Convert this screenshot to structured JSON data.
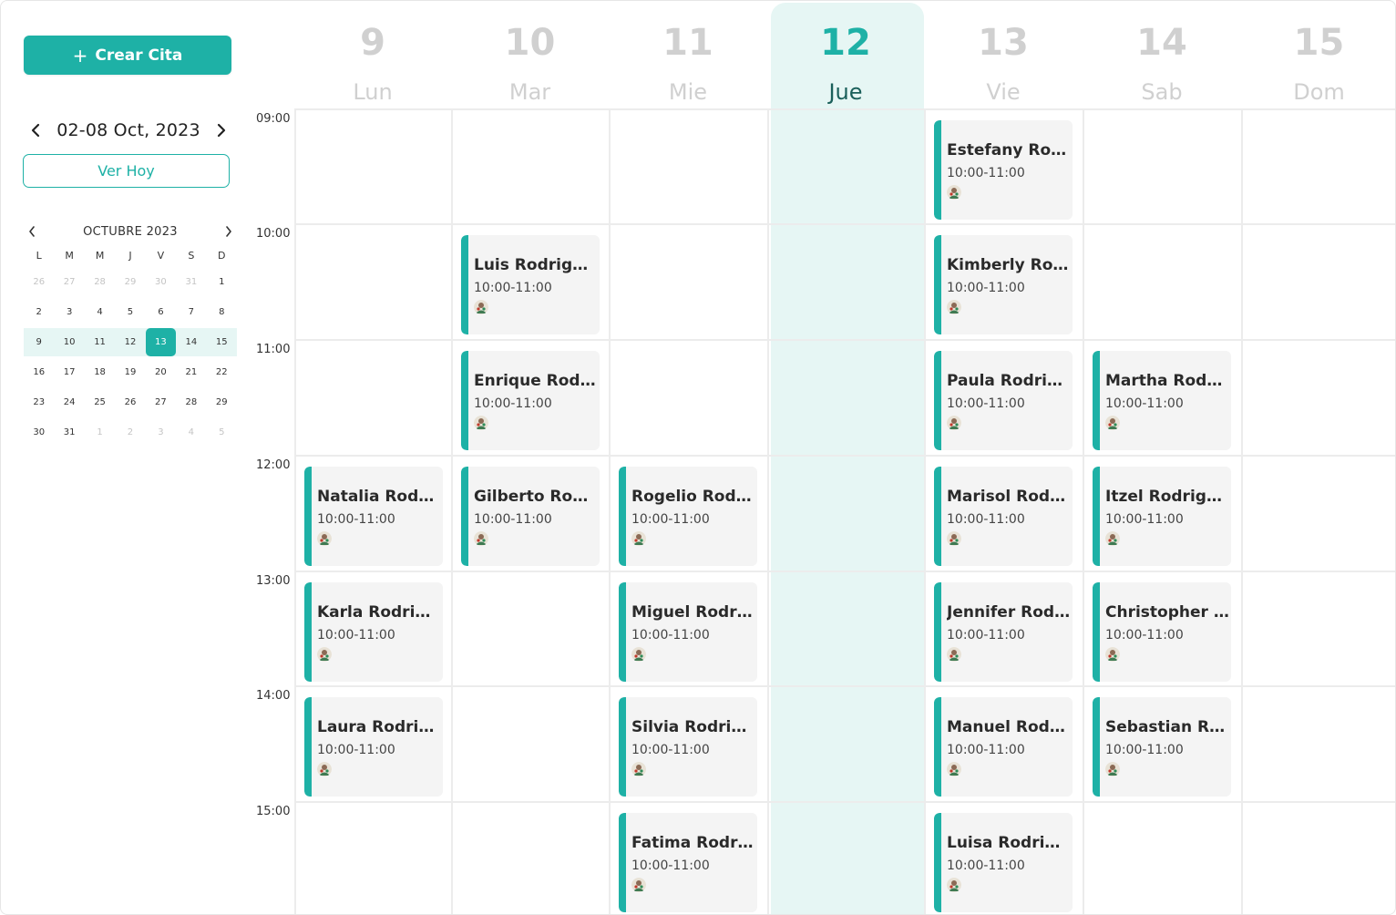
{
  "sidebar": {
    "create_label": "Crear Cita",
    "range_label": "02-08 Oct, 2023",
    "today_label": "Ver Hoy",
    "mini": {
      "title": "OCTUBRE 2023",
      "dow": [
        "L",
        "M",
        "M",
        "J",
        "V",
        "S",
        "D"
      ],
      "weeks": [
        [
          "26",
          "27",
          "28",
          "29",
          "30",
          "31",
          "1"
        ],
        [
          "2",
          "3",
          "4",
          "5",
          "6",
          "7",
          "8"
        ],
        [
          "9",
          "10",
          "11",
          "12",
          "13",
          "14",
          "15"
        ],
        [
          "16",
          "17",
          "18",
          "19",
          "20",
          "21",
          "22"
        ],
        [
          "23",
          "24",
          "25",
          "26",
          "27",
          "28",
          "29"
        ],
        [
          "30",
          "31",
          "1",
          "2",
          "3",
          "4",
          "5"
        ]
      ],
      "selected_day": "13"
    }
  },
  "days": [
    {
      "num": "9",
      "name": "Lun"
    },
    {
      "num": "10",
      "name": "Mar"
    },
    {
      "num": "11",
      "name": "Mie"
    },
    {
      "num": "12",
      "name": "Jue",
      "active": true
    },
    {
      "num": "13",
      "name": "Vie"
    },
    {
      "num": "14",
      "name": "Sab"
    },
    {
      "num": "15",
      "name": "Dom"
    }
  ],
  "hours": [
    "09:00",
    "10:00",
    "11:00",
    "12:00",
    "13:00",
    "14:00",
    "15:00"
  ],
  "events": [
    {
      "day": 4,
      "slot": 0,
      "name": "Estefany Rodriguez",
      "time": "10:00-11:00"
    },
    {
      "day": 1,
      "slot": 1,
      "name": "Luis Rodriguez",
      "time": "10:00-11:00"
    },
    {
      "day": 4,
      "slot": 1,
      "name": "Kimberly Rodriguez",
      "time": "10:00-11:00"
    },
    {
      "day": 1,
      "slot": 2,
      "name": "Enrique Rodriguez",
      "time": "10:00-11:00"
    },
    {
      "day": 4,
      "slot": 2,
      "name": "Paula Rodriguez",
      "time": "10:00-11:00"
    },
    {
      "day": 5,
      "slot": 2,
      "name": "Martha Rodriguez",
      "time": "10:00-11:00"
    },
    {
      "day": 0,
      "slot": 3,
      "name": "Natalia Rodriguez",
      "time": "10:00-11:00"
    },
    {
      "day": 1,
      "slot": 3,
      "name": "Gilberto Rodriguez",
      "time": "10:00-11:00"
    },
    {
      "day": 2,
      "slot": 3,
      "name": "Rogelio Rodriguez",
      "time": "10:00-11:00"
    },
    {
      "day": 4,
      "slot": 3,
      "name": "Marisol Rodriguez",
      "time": "10:00-11:00"
    },
    {
      "day": 5,
      "slot": 3,
      "name": "Itzel Rodriguez",
      "time": "10:00-11:00"
    },
    {
      "day": 0,
      "slot": 4,
      "name": "Karla Rodriguez",
      "time": "10:00-11:00"
    },
    {
      "day": 2,
      "slot": 4,
      "name": "Miguel Rodriguez",
      "time": "10:00-11:00"
    },
    {
      "day": 4,
      "slot": 4,
      "name": "Jennifer Rodriguez",
      "time": "10:00-11:00"
    },
    {
      "day": 5,
      "slot": 4,
      "name": "Christopher Rodriguez",
      "time": "10:00-11:00"
    },
    {
      "day": 0,
      "slot": 5,
      "name": "Laura Rodriguez",
      "time": "10:00-11:00"
    },
    {
      "day": 2,
      "slot": 5,
      "name": "Silvia Rodriguez",
      "time": "10:00-11:00"
    },
    {
      "day": 4,
      "slot": 5,
      "name": "Manuel Rodriguez",
      "time": "10:00-11:00"
    },
    {
      "day": 5,
      "slot": 5,
      "name": "Sebastian Rodriguez",
      "time": "10:00-11:00"
    },
    {
      "day": 2,
      "slot": 6,
      "name": "Fatima Rodriguez",
      "time": "10:00-11:00"
    },
    {
      "day": 4,
      "slot": 6,
      "name": "Luisa Rodriguez",
      "time": "10:00-11:00"
    }
  ],
  "colors": {
    "accent": "#1eb1a6",
    "today_bg": "#e6f6f4",
    "event_bg": "#f4f4f4"
  }
}
